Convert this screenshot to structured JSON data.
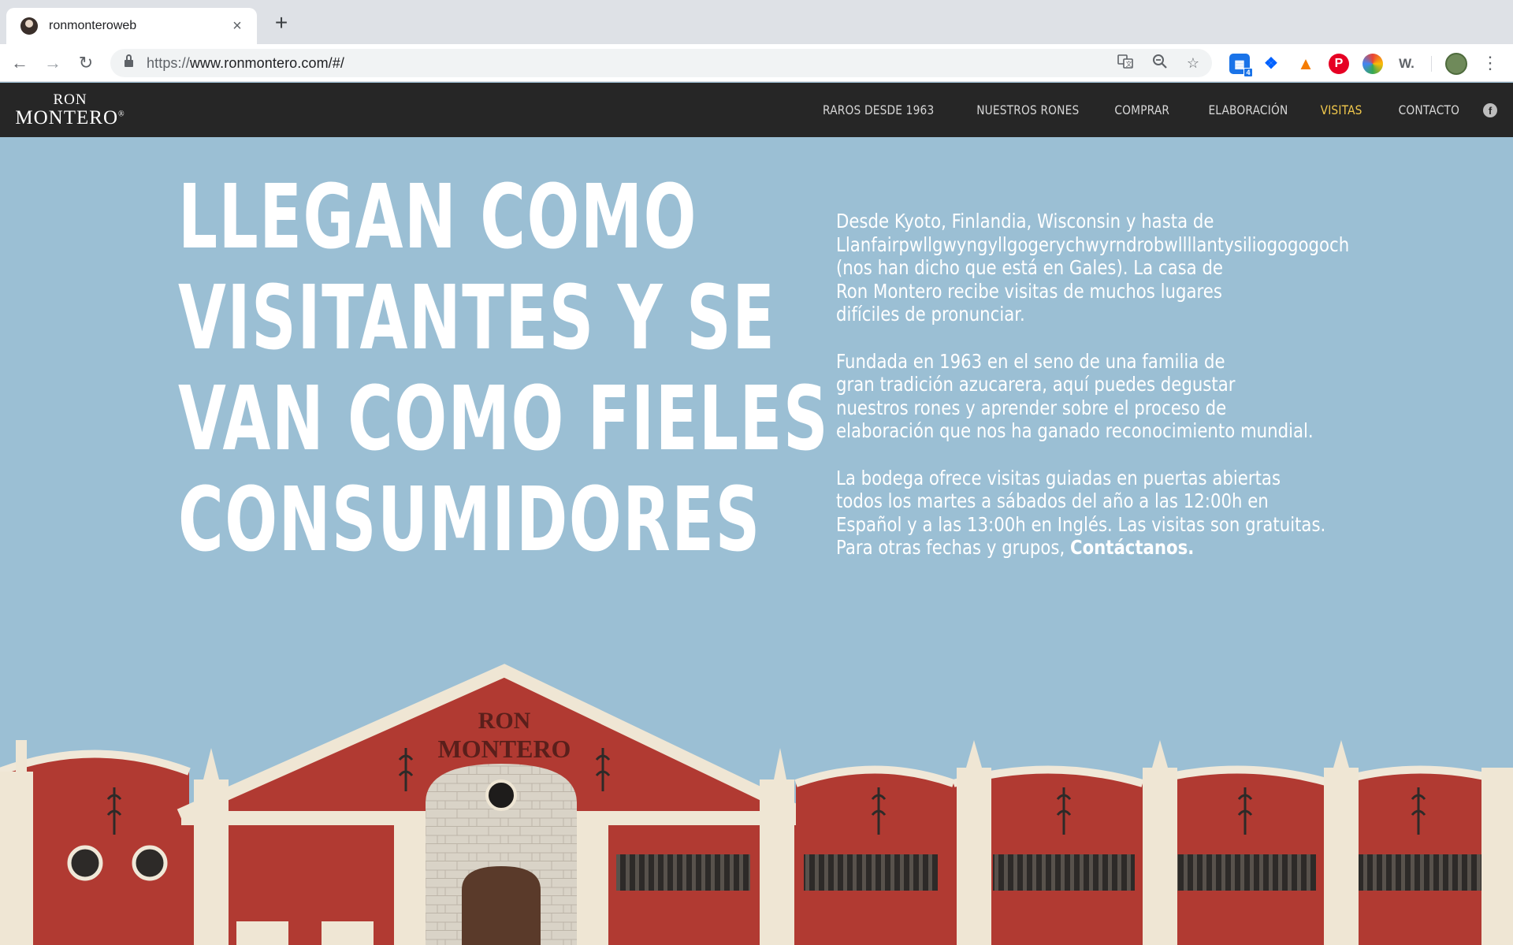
{
  "browser": {
    "tab_title": "ronmonteroweb",
    "new_tab": "+",
    "url_scheme": "https://",
    "url_rest": "www.ronmontero.com/#/",
    "extensions": [
      {
        "name": "video-extension-icon",
        "badge": "4",
        "color": "#1a73e8"
      },
      {
        "name": "dropbox-icon",
        "color": "#0061ff"
      },
      {
        "name": "warning-extension-icon",
        "color": "#f57c00"
      },
      {
        "name": "pinterest-icon",
        "color": "#e60023"
      },
      {
        "name": "color-picker-icon",
        "color": "#f4b400"
      },
      {
        "name": "w-extension-icon",
        "label": "W.",
        "color": "#5f6368"
      }
    ]
  },
  "site": {
    "logo": {
      "line1": "RON",
      "line2": "MONTERO",
      "mark": "®"
    },
    "nav": [
      {
        "label": "RAROS DESDE 1963",
        "active": false
      },
      {
        "label": "NUESTROS RONES",
        "active": false
      },
      {
        "label": "COMPRAR",
        "active": false
      },
      {
        "label": "ELABORACIÓN",
        "active": false
      },
      {
        "label": "VISITAS",
        "active": true
      },
      {
        "label": "CONTACTO",
        "active": false
      }
    ],
    "facebook_glyph": "f",
    "accent_color": "#f2c94c",
    "nav_bg": "#262626",
    "hero_bg": "#9bbfd4"
  },
  "hero": {
    "headline": [
      "LLEGAN COMO",
      "VISITANTES Y SE",
      "VAN COMO FIELES",
      "CONSUMIDORES"
    ],
    "paragraphs": [
      "Desde Kyoto, Finlandia, Wisconsin y hasta de\nLlanfairpwllgwyngyllgogerychwyrndrobwllllantysiliogogogoch\n(nos han dicho que está en Gales). La casa de\nRon Montero recibe visitas de muchos lugares\ndifíciles de pronunciar.",
      "Fundada en 1963 en el seno de una familia de\ngran tradición azucarera, aquí puedes degustar\nnuestros rones y aprender sobre el proceso de\nelaboración que nos ha ganado reconocimiento mundial."
    ],
    "paragraph3": "La bodega ofrece visitas guiadas en puertas abiertas\ntodos los martes a sábados del año a las 12:00h en\nEspañol y a las 13:00h en Inglés. Las visitas son gratuitas.\nPara otras fechas y grupos, ",
    "contact_link": "Contáctanos.",
    "building_sign": [
      "RON",
      "MONTERO"
    ]
  }
}
